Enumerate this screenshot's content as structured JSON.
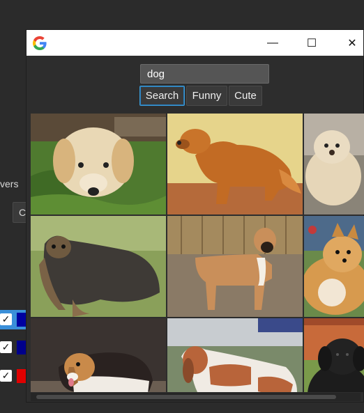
{
  "background_app": {
    "partial_label": "vers",
    "partial_button": "C",
    "rows": [
      {
        "checked": true,
        "selected": true,
        "color": "#0000a0"
      },
      {
        "checked": true,
        "selected": false,
        "color": "#00008b"
      },
      {
        "checked": true,
        "selected": false,
        "color": "#e00000"
      }
    ]
  },
  "window": {
    "app_icon": "google-g-icon",
    "controls": {
      "minimize": "—",
      "maximize": "☐",
      "close": "✕"
    },
    "search": {
      "value": "dog"
    },
    "buttons": {
      "search": "Search",
      "funny": "Funny",
      "cute": "Cute"
    },
    "results": [
      {
        "name": "golden-puppy-on-grass"
      },
      {
        "name": "golden-retriever-standing"
      },
      {
        "name": "cream-poodle-mix"
      },
      {
        "name": "silky-terrier"
      },
      {
        "name": "boxer-dog"
      },
      {
        "name": "pomeranian"
      },
      {
        "name": "beagle-lying"
      },
      {
        "name": "basset-hound"
      },
      {
        "name": "black-newfoundland"
      }
    ]
  }
}
